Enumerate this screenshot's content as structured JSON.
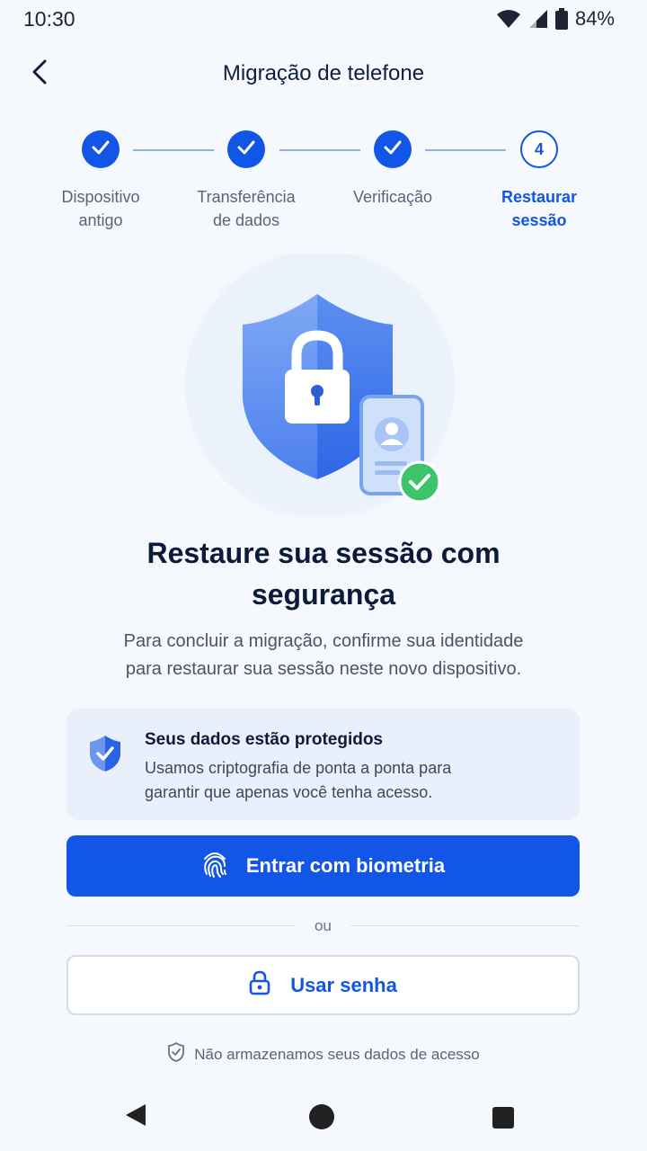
{
  "status_bar": {
    "time": "10:30",
    "battery": "84%"
  },
  "header": {
    "title": "Migração de telefone"
  },
  "stepper": {
    "steps": [
      {
        "number": "1",
        "label_line1": "Dispositivo",
        "label_line2": "antigo",
        "state": "done"
      },
      {
        "number": "2",
        "label_line1": "Transferência",
        "label_line2": "de dados",
        "state": "done"
      },
      {
        "number": "3",
        "label_line1": "Verificação",
        "label_line2": "",
        "state": "done"
      },
      {
        "number": "4",
        "label_line1": "Restaurar",
        "label_line2": "sessão",
        "state": "current"
      }
    ]
  },
  "main": {
    "headline_line1": "Restaure sua sessão com",
    "headline_line2": "segurança",
    "description_line1": "Para concluir a migração, confirme sua identidade",
    "description_line2": "para restaurar sua sessão neste novo dispositivo."
  },
  "info_card": {
    "title": "Seus dados estão protegidos",
    "text_line1": "Usamos criptografia de ponta a ponta para",
    "text_line2": "garantir que apenas você tenha acesso."
  },
  "actions": {
    "primary_label": "Entrar com biometria",
    "divider_text": "ou",
    "secondary_label": "Usar senha"
  },
  "footer": {
    "note": "Não armazenamos seus dados de acesso"
  },
  "colors": {
    "accent": "#1156e6",
    "background": "#f5f8fc",
    "success": "#3cc46b"
  },
  "icons": [
    "back-arrow-icon",
    "wifi-icon",
    "signal-icon",
    "battery-icon",
    "check-icon",
    "shield-lock-icon",
    "phone-icon",
    "shield-check-icon",
    "fingerprint-icon",
    "lock-icon",
    "shield-outline-icon",
    "nav-back-icon",
    "nav-home-icon",
    "nav-recents-icon"
  ]
}
